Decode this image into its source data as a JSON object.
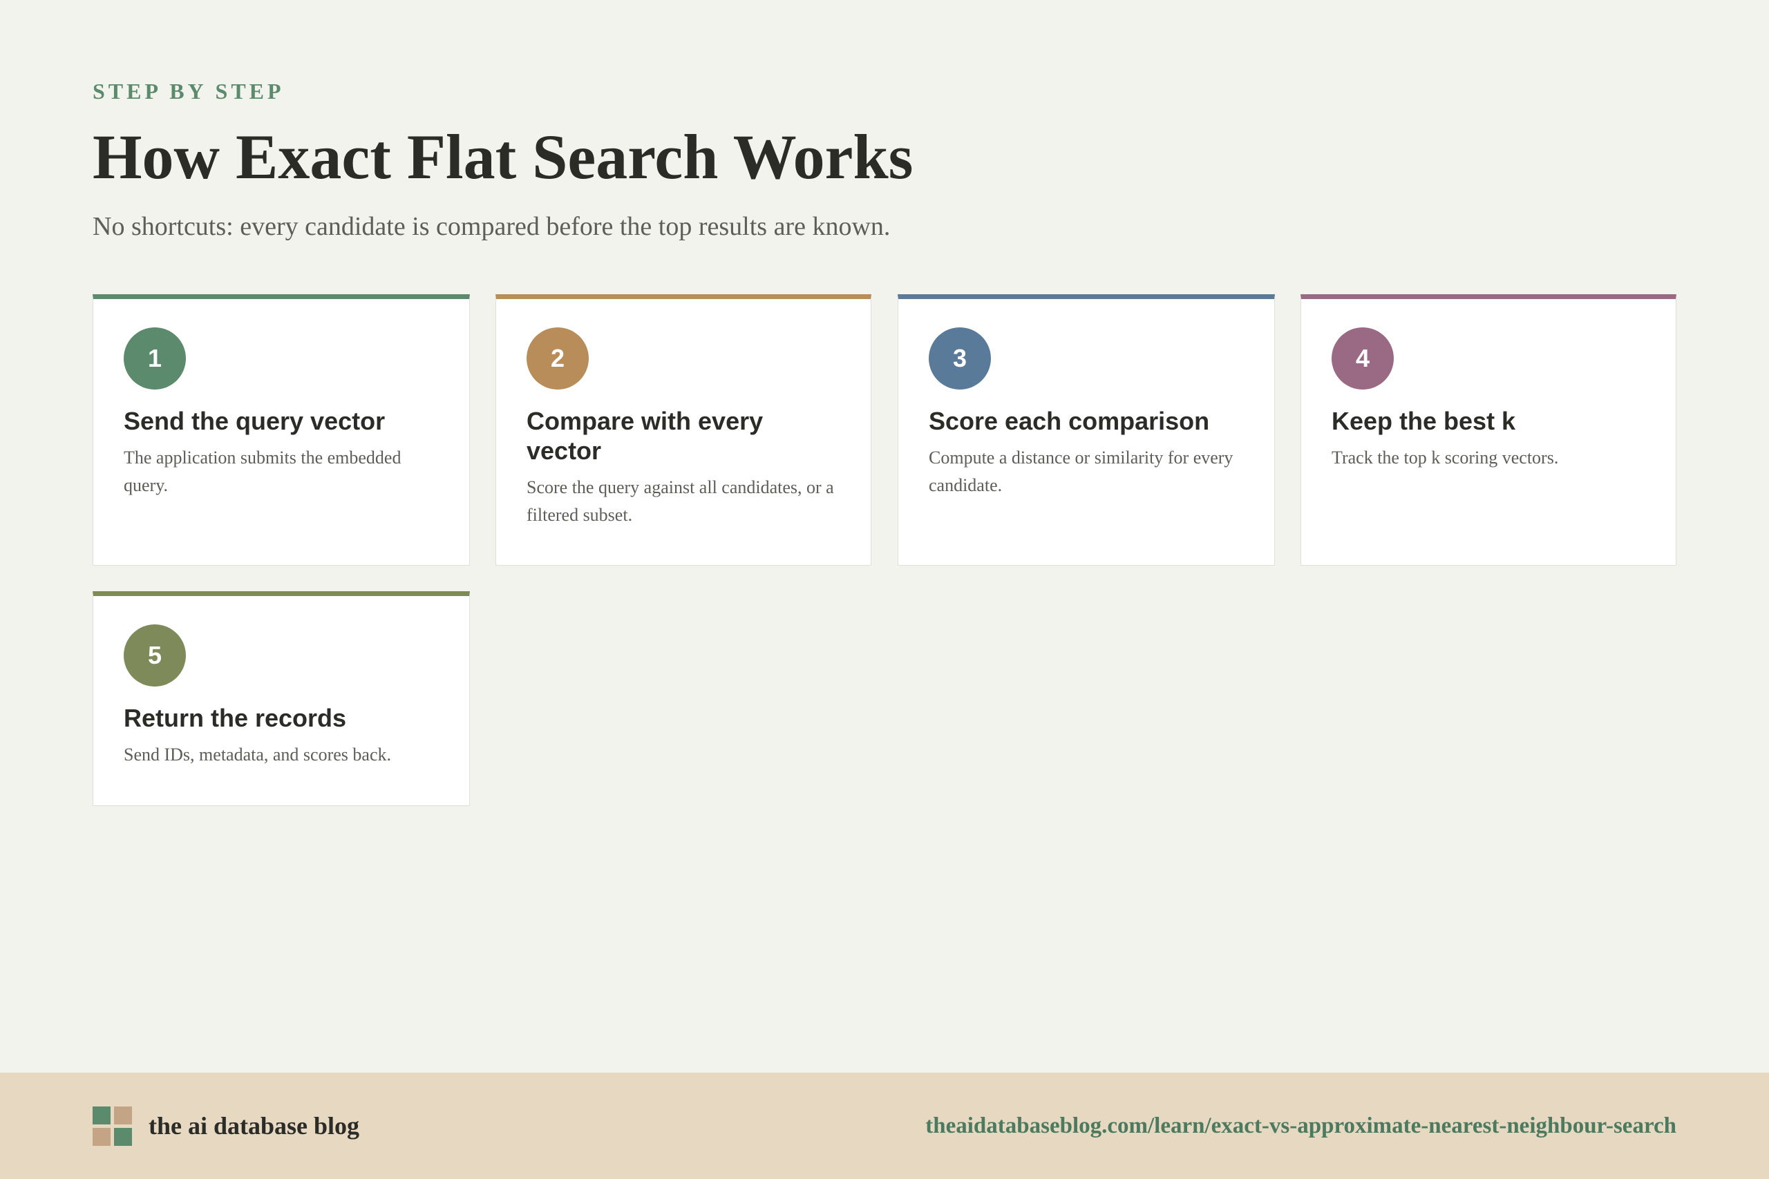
{
  "header": {
    "eyebrow": "STEP BY STEP",
    "title": "How Exact Flat Search Works",
    "subtitle": "No shortcuts: every candidate is compared before the top results are known."
  },
  "steps": [
    {
      "number": "1",
      "title": "Send the query vector",
      "description": "The application submits the embedded query.",
      "color": "#5b8a6d"
    },
    {
      "number": "2",
      "title": "Compare with every vector",
      "description": "Score the query against all candidates, or a filtered subset.",
      "color": "#b98d5a"
    },
    {
      "number": "3",
      "title": "Score each comparison",
      "description": "Compute a distance or similarity for every candidate.",
      "color": "#5a7a9a"
    },
    {
      "number": "4",
      "title": "Keep the best k",
      "description": "Track the top k scoring vectors.",
      "color": "#9a6a84"
    },
    {
      "number": "5",
      "title": "Return the records",
      "description": "Send IDs, metadata, and scores back.",
      "color": "#7e8a5a"
    }
  ],
  "footer": {
    "brand": "the ai database blog",
    "url": "theaidatabaseblog.com/learn/exact-vs-approximate-nearest-neighbour-search",
    "logo_colors": [
      "#5b8a6d",
      "#c4a484",
      "#c4a484",
      "#5b8a6d"
    ],
    "background": "#e6d8c1"
  }
}
